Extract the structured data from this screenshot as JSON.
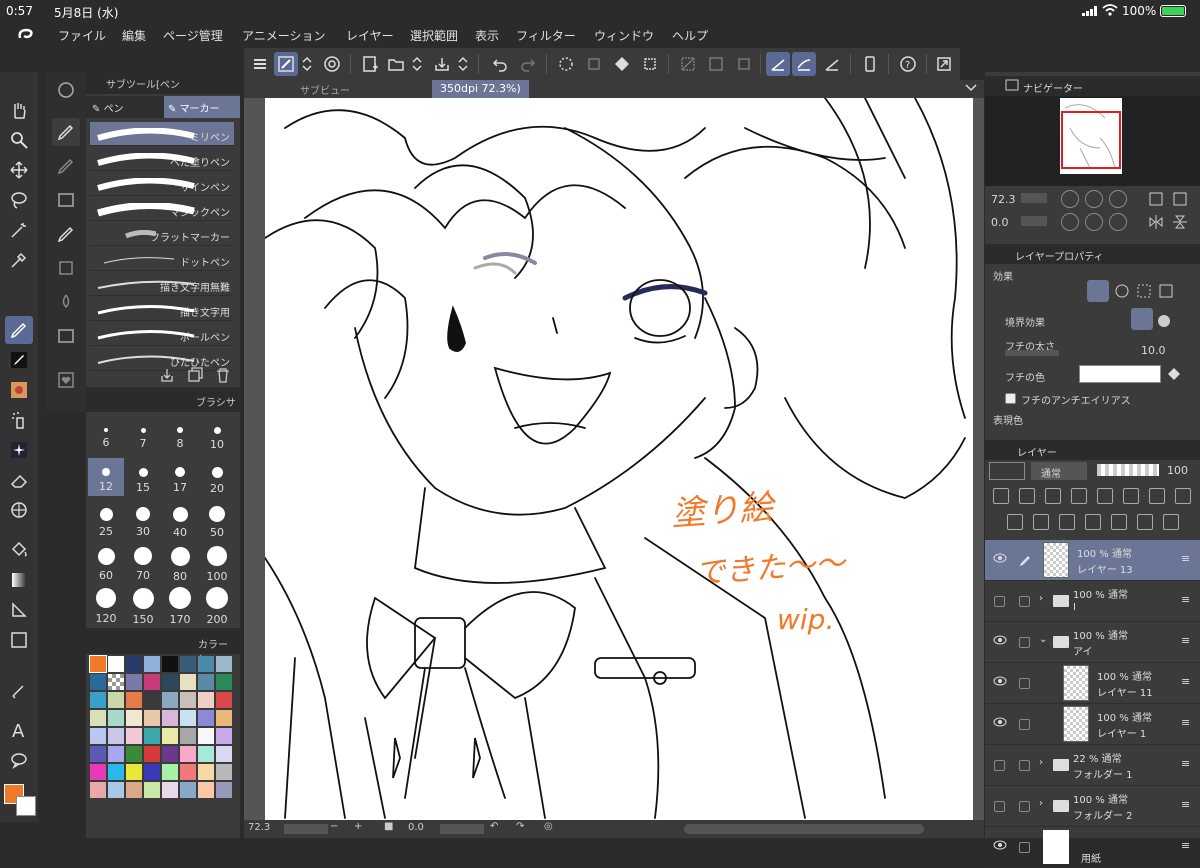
{
  "status": {
    "time": "0:57",
    "date": "5月8日 (水)",
    "battery": "100%"
  },
  "menu": [
    "ファイル",
    "編集",
    "ページ管理",
    "アニメーション",
    "レイヤー",
    "選択範囲",
    "表示",
    "フィルター",
    "ウィンドウ",
    "ヘルプ"
  ],
  "canvas_tab": {
    "left": "サブビュー",
    "right": "350dpi 72.3%)"
  },
  "subtool": {
    "title": "サブツール[ペン",
    "tabs": [
      "ペン",
      "マーカー"
    ],
    "brushes": [
      "ミリペン",
      "べた塗りペン",
      "サインペン",
      "マジックペン",
      "フラットマーカー",
      "ドットペン",
      "描き文字用無難",
      "描き文字用",
      "ボールペン",
      "ひたひたペン"
    ]
  },
  "brushsize": {
    "title": "ブラシサ",
    "sizes": [
      "6",
      "7",
      "8",
      "10",
      "12",
      "15",
      "17",
      "20",
      "25",
      "30",
      "40",
      "50",
      "60",
      "70",
      "80",
      "100",
      "120",
      "150",
      "170",
      "200"
    ]
  },
  "colorpanel": {
    "title": "カラーヒ"
  },
  "navigator": {
    "title": "ナビゲーター",
    "zoom": "72.3",
    "angle": "0.0"
  },
  "layerprop": {
    "title": "レイヤープロパティ",
    "effect_label": "効果",
    "border_effect": "境界効果",
    "edge_width_label": "フチの太さ",
    "edge_width_value": "10.0",
    "edge_color_label": "フチの色",
    "antialias_label": "フチのアンチエイリアス",
    "expression_label": "表現色"
  },
  "layers": {
    "title": "レイヤー",
    "blend_mode": "通常",
    "opacity": "100",
    "items": [
      {
        "mode": "100 % 通常",
        "name": "レイヤー 13"
      },
      {
        "mode": "100 % 通常",
        "name": "I"
      },
      {
        "mode": "100 % 通常",
        "name": "アイ"
      },
      {
        "mode": "100 % 通常",
        "name": "レイヤー 11"
      },
      {
        "mode": "100 % 通常",
        "name": "レイヤー 1"
      },
      {
        "mode": "22 % 通常",
        "name": "フォルダー 1"
      },
      {
        "mode": "100 % 通常",
        "name": "フォルダー 2"
      },
      {
        "mode": "",
        "name": "用紙"
      }
    ]
  },
  "bottom": {
    "zoom": "72.3",
    "angle": "0.0"
  },
  "annotation": {
    "line1": "塗り絵",
    "line2": "できた〜〜",
    "line3": "wip."
  },
  "colors": {
    "accent": "#5a6a95",
    "selected_row": "#6b7696",
    "main_color": "#f07a2a",
    "annotation": "#f07a2a"
  }
}
